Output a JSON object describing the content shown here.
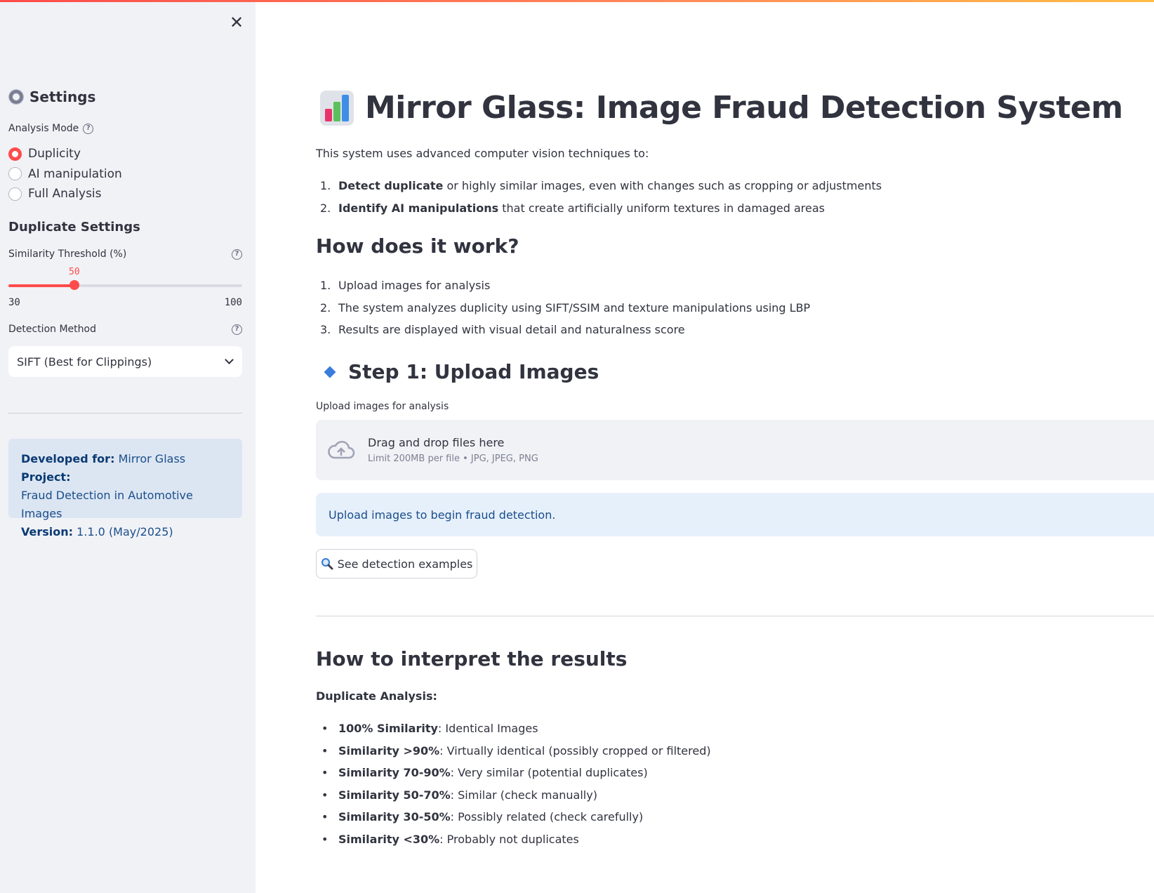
{
  "sidebar": {
    "close_symbol": "✕",
    "settings_heading": "Settings",
    "analysis_mode_label": "Analysis Mode",
    "help_symbol": "?",
    "modes": [
      {
        "label": "Duplicity",
        "selected": true
      },
      {
        "label": "AI manipulation",
        "selected": false
      },
      {
        "label": "Full Analysis",
        "selected": false
      }
    ],
    "duplicate_settings_heading": "Duplicate Settings",
    "similarity_label": "Similarity Threshold (%)",
    "slider": {
      "value": "50",
      "min": "30",
      "max": "100"
    },
    "detection_method_label": "Detection Method",
    "detection_method_value": "SIFT (Best for Clippings)",
    "info": {
      "developed_for_label": "Developed for:",
      "project_name": "Mirror Glass",
      "project_label": "Project:",
      "project_desc": "Fraud Detection in Automotive Images",
      "version_label": "Version:",
      "version_value": "1.1.0 (May/2025)"
    }
  },
  "main": {
    "title": "Mirror Glass: Image Fraud Detection System",
    "intro": "This system uses advanced computer vision techniques to:",
    "capabilities": [
      {
        "num": "1.",
        "bold": "Detect duplicate",
        "rest": " or highly similar images, even with changes such as cropping or adjustments"
      },
      {
        "num": "2.",
        "bold": "Identify AI manipulations",
        "rest": " that create artificially uniform textures in damaged areas"
      }
    ],
    "how_heading": "How does it work?",
    "how_steps": [
      {
        "num": "1.",
        "text": "Upload images for analysis"
      },
      {
        "num": "2.",
        "text": "The system analyzes duplicity using SIFT/SSIM and texture manipulations using LBP"
      },
      {
        "num": "3.",
        "text": "Results are displayed with visual detail and naturalness score"
      }
    ],
    "step1_heading": "Step 1: Upload Images",
    "upload_label": "Upload images for analysis",
    "dropzone_main": "Drag and drop files here",
    "dropzone_sub": "Limit 200MB per file • JPG, JPEG, PNG",
    "alert_text": "Upload images to begin fraud detection.",
    "examples_button": "See detection examples",
    "interpret_heading": "How to interpret the results",
    "duplicate_analysis_label": "Duplicate Analysis:",
    "bullet_symbol": "•",
    "interpretations": [
      {
        "bold": "100% Similarity",
        "rest": ": Identical Images"
      },
      {
        "bold": "Similarity >90%",
        "rest": ": Virtually identical (possibly cropped or filtered)"
      },
      {
        "bold": "Similarity 70-90%",
        "rest": ": Very similar (potential duplicates)"
      },
      {
        "bold": "Similarity 50-70%",
        "rest": ": Similar (check manually)"
      },
      {
        "bold": "Similarity 30-50%",
        "rest": ": Possibly related (check carefully)"
      },
      {
        "bold": "Similarity <30%",
        "rest": ": Probably not duplicates"
      }
    ]
  },
  "colors": {
    "accent": "#ff4b4b",
    "info_bg": "#dce6f2",
    "sidebar_bg": "#f0f2f6"
  },
  "icons": {
    "close": "close-icon",
    "settings": "gear-icon",
    "chart": "bar-chart-icon",
    "step": "diamond-icon",
    "upload": "cloud-upload-icon",
    "search": "magnifier-icon"
  }
}
